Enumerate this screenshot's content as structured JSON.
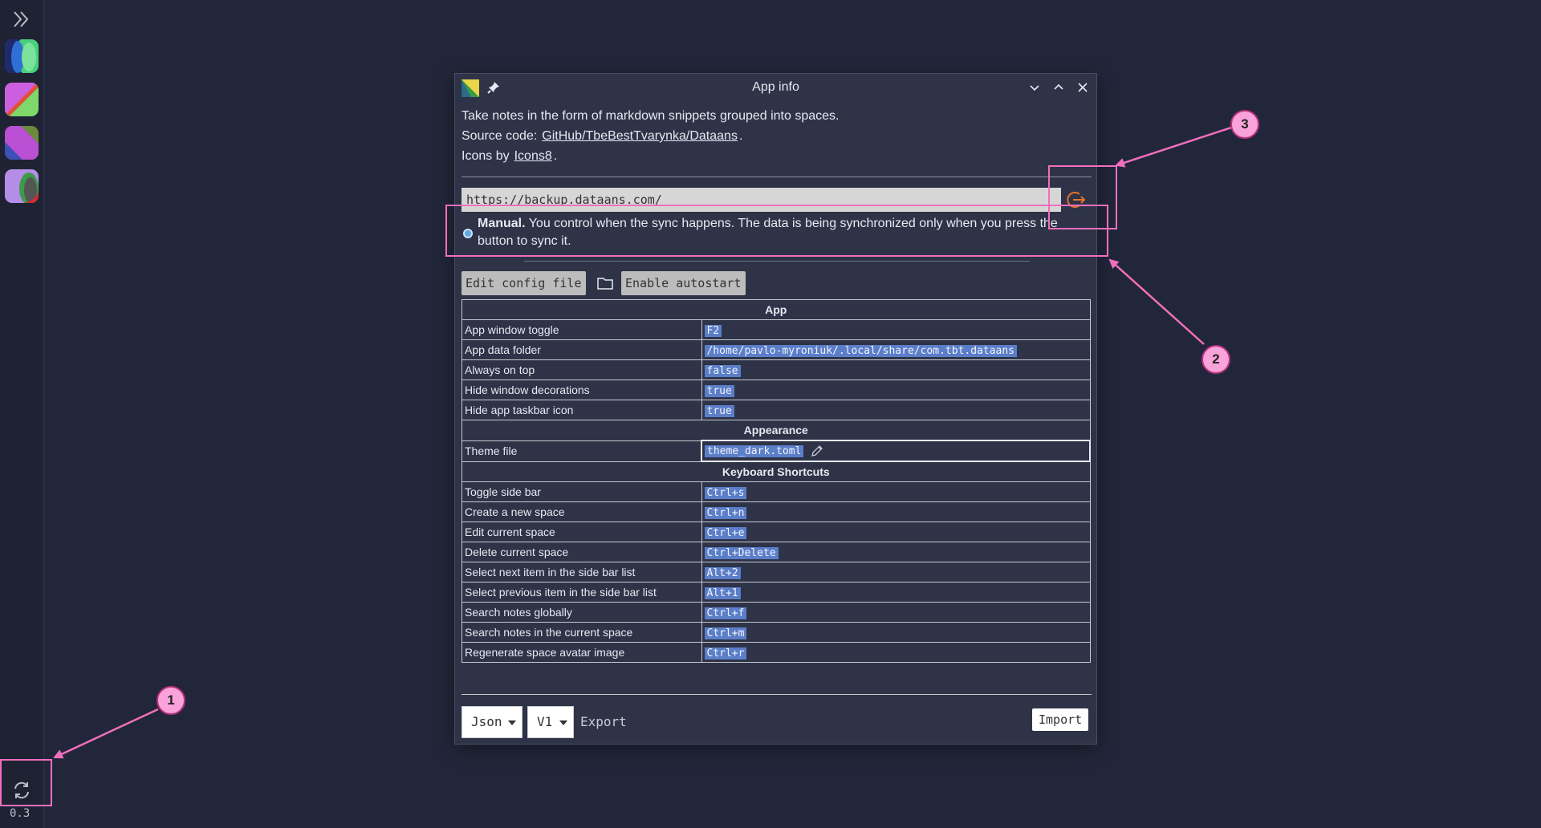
{
  "sidebar": {
    "version": "0.3",
    "avatars": [
      {
        "name": "space-avatar-1",
        "colors": [
          "#2f6fd6",
          "#4ad07c",
          "#1d2a6b"
        ]
      },
      {
        "name": "space-avatar-2",
        "colors": [
          "#cc5fe0",
          "#7ed86a",
          "#e0503a"
        ]
      },
      {
        "name": "space-avatar-3",
        "colors": [
          "#3e4fb8",
          "#b94fd3",
          "#6b8a3c"
        ]
      },
      {
        "name": "space-avatar-4",
        "colors": [
          "#b48ee6",
          "#3d9a4a",
          "#d12b2b"
        ]
      }
    ]
  },
  "window": {
    "title": "App info",
    "description": "Take notes in the form of markdown snippets grouped into spaces.",
    "source_label": "Source code:",
    "source_link": "GitHub/TbeBestTvarynka/Dataans",
    "icons_label": "Icons by",
    "icons_link": "Icons8",
    "period": ".",
    "sync": {
      "url": "https://backup.dataans.com/",
      "mode_bold": "Manual.",
      "mode_text": "You control when the sync happens. The data is being synchronized only when you press the button to sync it."
    },
    "buttons": {
      "edit_config": "Edit config file",
      "enable_autostart": "Enable autostart"
    },
    "sections": {
      "app": "App",
      "appearance": "Appearance",
      "shortcuts": "Keyboard Shortcuts"
    },
    "app_rows": [
      {
        "key": "App window toggle",
        "value": "F2"
      },
      {
        "key": "App data folder",
        "value": "/home/pavlo-myroniuk/.local/share/com.tbt.dataans"
      },
      {
        "key": "Always on top",
        "value": "false"
      },
      {
        "key": "Hide window decorations",
        "value": "true"
      },
      {
        "key": "Hide app taskbar icon",
        "value": "true"
      }
    ],
    "theme": {
      "key": "Theme file",
      "value": "theme_dark.toml"
    },
    "shortcut_rows": [
      {
        "key": "Toggle side bar",
        "value": "Ctrl+s"
      },
      {
        "key": "Create a new space",
        "value": "Ctrl+n"
      },
      {
        "key": "Edit current space",
        "value": "Ctrl+e"
      },
      {
        "key": "Delete current space",
        "value": "Ctrl+Delete"
      },
      {
        "key": "Select next item in the side bar list",
        "value": "Alt+2"
      },
      {
        "key": "Select previous item in the side bar list",
        "value": "Alt+1"
      },
      {
        "key": "Search notes globally",
        "value": "Ctrl+f"
      },
      {
        "key": "Search notes in the current space",
        "value": "Ctrl+m"
      },
      {
        "key": "Regenerate space avatar image",
        "value": "Ctrl+r"
      }
    ],
    "footer": {
      "format": "Json",
      "version": "V1",
      "export": "Export",
      "import": "Import"
    }
  },
  "annotations": [
    {
      "number": "1"
    },
    {
      "number": "2"
    },
    {
      "number": "3"
    }
  ],
  "colors": {
    "background": "#22263a",
    "window": "#2e3347",
    "code_badge": "#5b7ec9",
    "accent_orange": "#e8702a",
    "annotation_pink": "#f06fbd"
  }
}
